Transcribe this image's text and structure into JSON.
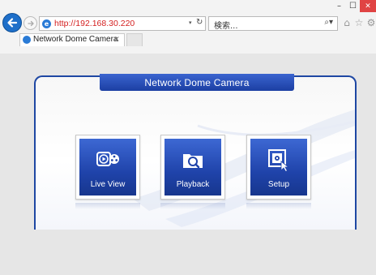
{
  "browser": {
    "address_url": "http://192.168.30.220",
    "search_placeholder": "検索...",
    "tab_title": "Network Dome Camera",
    "tab_close": "×",
    "address_dropdown": "▾",
    "refresh_glyph": "↻",
    "search_glyph": "⌕▾",
    "window_controls": {
      "minimize": "–",
      "maximize": "☐",
      "close": "✕"
    },
    "toolbar_icons": [
      "home-icon",
      "favorites-star-icon",
      "settings-gear-icon"
    ]
  },
  "page": {
    "panel_title": "Network Dome Camera",
    "tiles": [
      {
        "label": "Live View",
        "icon": "live-view-icon"
      },
      {
        "label": "Playback",
        "icon": "playback-search-icon"
      },
      {
        "label": "Setup",
        "icon": "setup-cursor-icon"
      }
    ]
  },
  "colors": {
    "brand_blue": "#1f43aa",
    "panel_border": "#1e47a3",
    "url_red": "#d41f1f",
    "close_red": "#e04343",
    "back_button": "#1e6fc9"
  }
}
